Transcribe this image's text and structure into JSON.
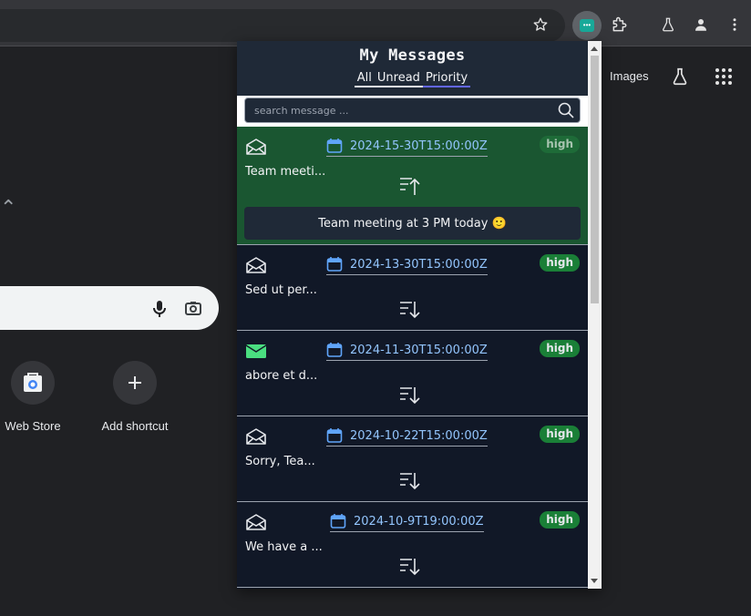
{
  "browser": {
    "toolbar_icons": [
      "star-icon",
      "extension-chip-icon",
      "puzzle-icon",
      "flask-icon",
      "profile-icon",
      "menu-icon"
    ]
  },
  "ntp": {
    "images_link": "Images",
    "shortcuts": [
      {
        "label": "Web Store",
        "icon": "web-store-icon"
      },
      {
        "label": "Add shortcut",
        "icon": "plus-icon"
      }
    ]
  },
  "popup": {
    "title": "My Messages",
    "tabs": [
      "All",
      "Unread",
      "Priority"
    ],
    "active_tab": "Priority",
    "search_placeholder": "search message ...",
    "messages": [
      {
        "date": "2024-15-30T15:00:00Z",
        "priority": "high",
        "preview": "Team meeti...",
        "full": "Team meeting at 3 PM today 🙂",
        "read": true,
        "expanded": true
      },
      {
        "date": "2024-13-30T15:00:00Z",
        "priority": "high",
        "preview": "Sed ut per...",
        "read": true,
        "expanded": false
      },
      {
        "date": "2024-11-30T15:00:00Z",
        "priority": "high",
        "preview": "abore et d...",
        "read": false,
        "expanded": false
      },
      {
        "date": "2024-10-22T15:00:00Z",
        "priority": "high",
        "preview": "Sorry, Tea...",
        "read": true,
        "expanded": false
      },
      {
        "date": "2024-10-9T19:00:00Z",
        "priority": "high",
        "preview": "We have a ...",
        "read": true,
        "expanded": false
      }
    ]
  },
  "colors": {
    "popup_bg": "#111827",
    "header_bg": "#1f2937",
    "expanded_bg": "#1a5631",
    "badge_bg": "#1a7f37",
    "date_color": "#93c5fd",
    "unread_icon": "#4ade80",
    "active_tab_underline": "#6366f1"
  }
}
